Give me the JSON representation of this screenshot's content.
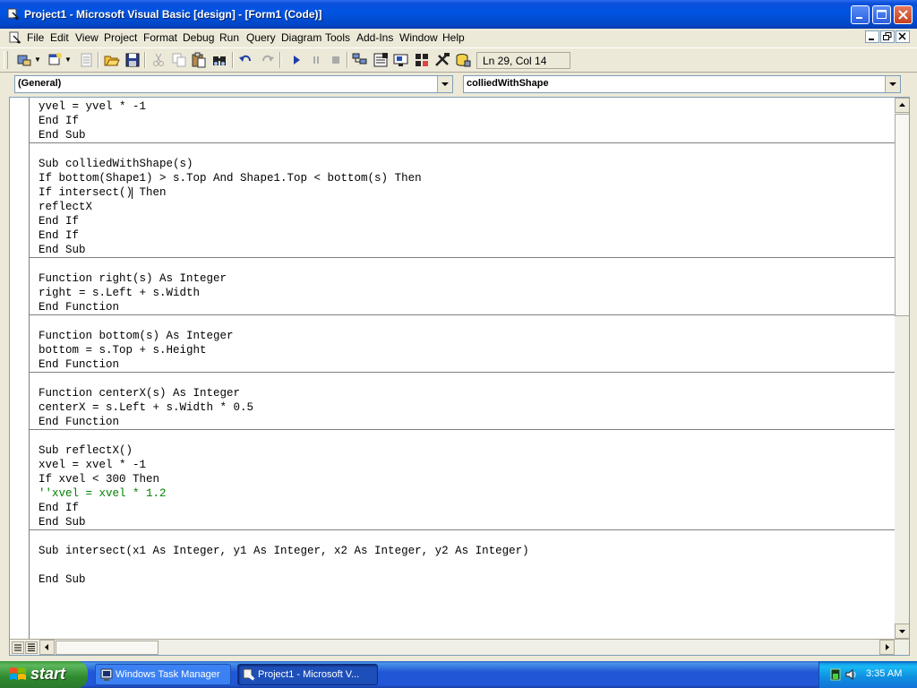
{
  "window": {
    "title": "Project1 - Microsoft Visual Basic [design] - [Form1 (Code)]"
  },
  "menu": [
    "File",
    "Edit",
    "View",
    "Project",
    "Format",
    "Debug",
    "Run",
    "Query",
    "Diagram",
    "Tools",
    "Add-Ins",
    "Window",
    "Help"
  ],
  "toolbar": {
    "icons": [
      "add-project-icon",
      "add-form-icon",
      "menu-editor-icon",
      "open-icon",
      "save-icon",
      "cut-icon",
      "copy-icon",
      "paste-icon",
      "find-icon",
      "undo-icon",
      "redo-icon",
      "run-icon",
      "pause-icon",
      "stop-icon",
      "project-explorer-icon",
      "properties-icon",
      "form-layout-icon",
      "object-browser-icon",
      "toolbox-icon",
      "data-view-icon"
    ],
    "status": "Ln 29, Col 14"
  },
  "object_combo": {
    "value": "(General)"
  },
  "proc_combo": {
    "value": "colliedWithShape"
  },
  "code": {
    "lines": [
      "yvel = yvel * -1",
      "End If",
      "End Sub",
      "",
      "Sub colliedWithShape(s)",
      "If bottom(Shape1) > s.Top And Shape1.Top < bottom(s) Then",
      "If intersect() Then",
      "reflectX",
      "End If",
      "End If",
      "End Sub",
      "",
      "Function right(s) As Integer",
      "right = s.Left + s.Width",
      "End Function",
      "",
      "Function bottom(s) As Integer",
      "bottom = s.Top + s.Height",
      "End Function",
      "",
      "Function centerX(s) As Integer",
      "centerX = s.Left + s.Width * 0.5",
      "End Function",
      "",
      "Sub reflectX()",
      "xvel = xvel * -1",
      "If xvel < 300 Then",
      "''xvel = xvel * 1.2",
      "End If",
      "End Sub",
      "",
      "Sub intersect(x1 As Integer, y1 As Integer, x2 As Integer, y2 As Integer)",
      "",
      "End Sub"
    ]
  },
  "taskbar": {
    "start": "start",
    "tasks": [
      {
        "label": "Windows Task Manager",
        "icon": "task-manager-icon"
      },
      {
        "label": "Project1 - Microsoft V...",
        "icon": "vb-icon"
      }
    ],
    "clock": "3:35 AM"
  }
}
